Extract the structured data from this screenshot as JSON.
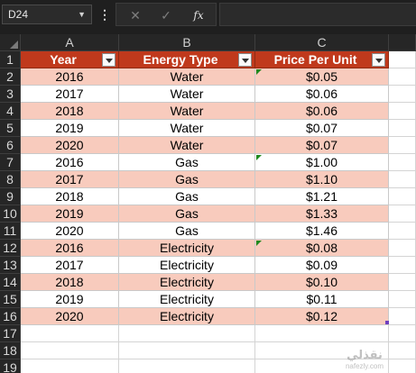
{
  "formula_bar": {
    "name_box": "D24",
    "dropdown_icon": "chevron-down-icon",
    "more_icon": "vertical-dots-icon",
    "cancel_icon": "close-icon",
    "enter_icon": "checkmark-icon",
    "fx_label": "fx",
    "formula": ""
  },
  "columns": [
    "A",
    "B",
    "C"
  ],
  "header": {
    "year": "Year",
    "energy_type": "Energy Type",
    "price": "Price Per Unit"
  },
  "rows": [
    {
      "row": "2",
      "year": "2016",
      "type": "Water",
      "price": "$0.05"
    },
    {
      "row": "3",
      "year": "2017",
      "type": "Water",
      "price": "$0.06"
    },
    {
      "row": "4",
      "year": "2018",
      "type": "Water",
      "price": "$0.06"
    },
    {
      "row": "5",
      "year": "2019",
      "type": "Water",
      "price": "$0.07"
    },
    {
      "row": "6",
      "year": "2020",
      "type": "Water",
      "price": "$0.07"
    },
    {
      "row": "7",
      "year": "2016",
      "type": "Gas",
      "price": "$1.00"
    },
    {
      "row": "8",
      "year": "2017",
      "type": "Gas",
      "price": "$1.10"
    },
    {
      "row": "9",
      "year": "2018",
      "type": "Gas",
      "price": "$1.21"
    },
    {
      "row": "10",
      "year": "2019",
      "type": "Gas",
      "price": "$1.33"
    },
    {
      "row": "11",
      "year": "2020",
      "type": "Gas",
      "price": "$1.46"
    },
    {
      "row": "12",
      "year": "2016",
      "type": "Electricity",
      "price": "$0.08"
    },
    {
      "row": "13",
      "year": "2017",
      "type": "Electricity",
      "price": "$0.09"
    },
    {
      "row": "14",
      "year": "2018",
      "type": "Electricity",
      "price": "$0.10"
    },
    {
      "row": "15",
      "year": "2019",
      "type": "Electricity",
      "price": "$0.11"
    },
    {
      "row": "16",
      "year": "2020",
      "type": "Electricity",
      "price": "$0.12"
    }
  ],
  "header_row_number": "1",
  "empty_rows": [
    "17",
    "18",
    "19"
  ],
  "colors": {
    "header_fill": "#c0391c",
    "band_fill": "#f8cbbd",
    "error_indicator": "#1f8a1f"
  },
  "watermark": {
    "logo": "نقذلي",
    "sub": "nafezly.com"
  }
}
